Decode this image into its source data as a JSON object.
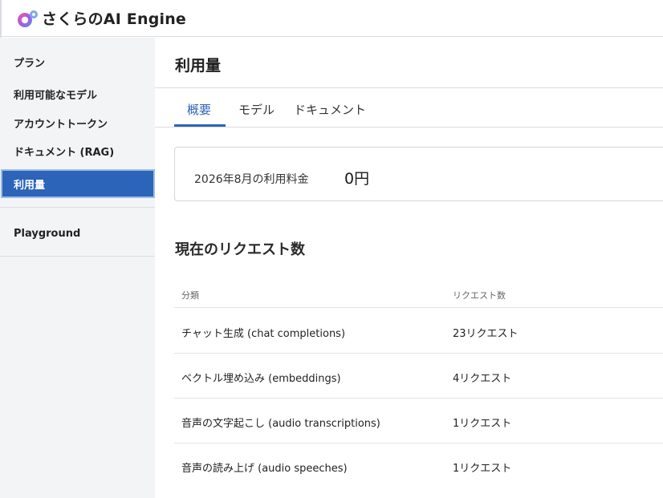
{
  "header": {
    "brand": "さくらのAI Engine",
    "logo_icon": "sakura-ai-engine-logo-icon",
    "colors": {
      "logo_pink": "#f05a9d",
      "logo_violet": "#8b5cf6",
      "logo_blue": "#5b8def"
    }
  },
  "sidebar": {
    "items": [
      {
        "label": "プラン"
      },
      {
        "label": "利用可能なモデル"
      },
      {
        "label": "アカウントトークン"
      },
      {
        "label": "ドキュメント (RAG)"
      },
      {
        "label": "利用量",
        "active": true
      }
    ],
    "secondary": [
      {
        "label": "Playground"
      }
    ],
    "active_color": "#2b64b8"
  },
  "main": {
    "title": "利用量",
    "tabs": [
      {
        "label": "概要",
        "active": true
      },
      {
        "label": "モデル"
      },
      {
        "label": "ドキュメント"
      }
    ],
    "summary": {
      "label": "2026年8月の利用料金",
      "value": "0円"
    },
    "requests": {
      "title": "現在のリクエスト数",
      "columns": [
        "分類",
        "リクエスト数"
      ],
      "rows": [
        [
          "チャット生成 (chat completions)",
          "23リクエスト"
        ],
        [
          "ベクトル埋め込み (embeddings)",
          "4リクエスト"
        ],
        [
          "音声の文字起こし (audio transcriptions)",
          "1リクエスト"
        ],
        [
          "音声の読み上げ (audio speeches)",
          "1リクエスト"
        ]
      ]
    }
  }
}
